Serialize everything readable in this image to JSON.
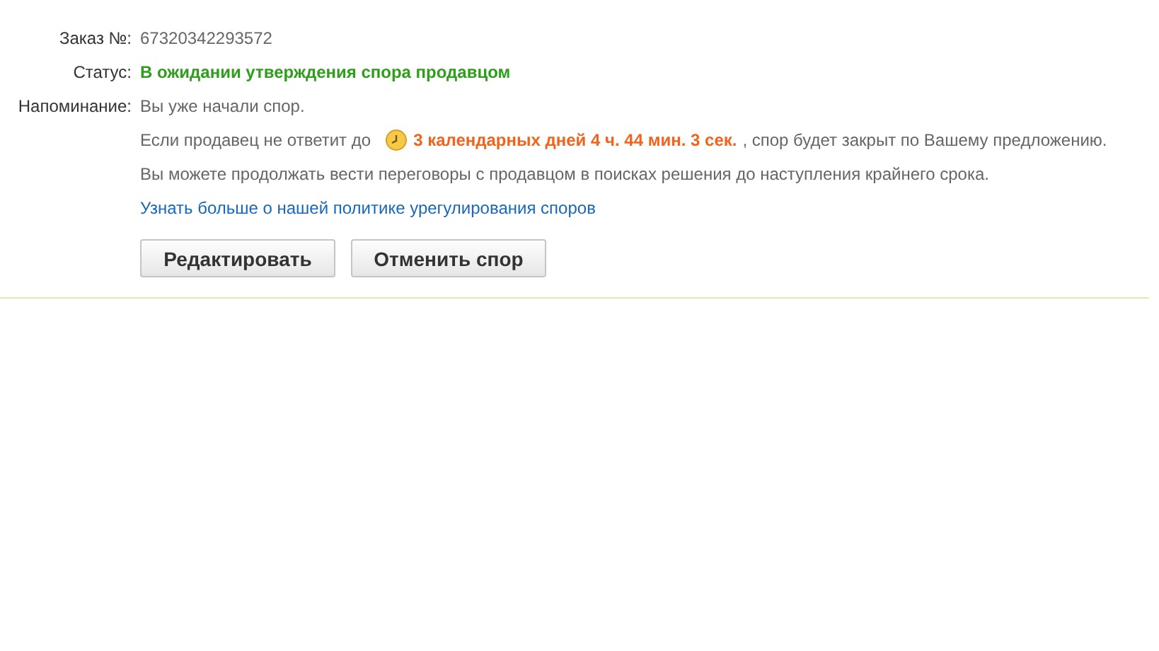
{
  "order": {
    "label": "Заказ №:",
    "value": "67320342293572"
  },
  "status": {
    "label": "Статус:",
    "value": "В ожидании утверждения спора продавцом"
  },
  "reminder": {
    "label": "Напоминание:",
    "value": "Вы уже начали спор.",
    "deadline": {
      "before": "Если продавец не ответит до",
      "countdown": "3 календарных дней 4 ч. 44 мин. 3 сек.",
      "after": ", спор будет закрыт по Вашему предложению."
    },
    "note": "Вы можете продолжать вести переговоры с продавцом в поисках решения до наступления крайнего срока.",
    "link": "Узнать больше о нашей политике урегулирования споров"
  },
  "buttons": [
    "Редактировать",
    "Отменить спор"
  ]
}
